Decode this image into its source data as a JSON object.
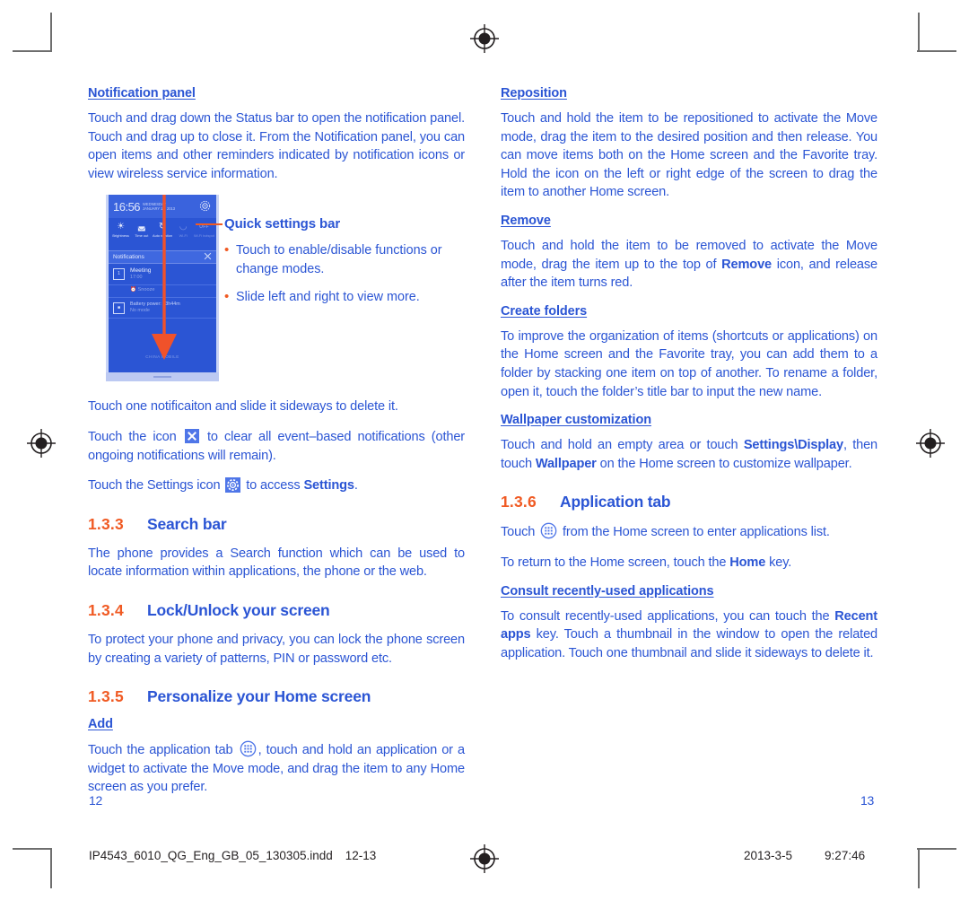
{
  "document": {
    "left_page_number": "12",
    "right_page_number": "13",
    "footer_filename": "IP4543_6010_QG_Eng_GB_05_130305.indd",
    "footer_pages": "12-13",
    "footer_date": "2013-3-5",
    "footer_time": "9:27:46"
  },
  "colors": {
    "body_blue": "#2b55d4",
    "accent_orange": "#f05a23",
    "phone_blue": "#2b55d4"
  },
  "left_column": {
    "notification_panel": {
      "heading": "Notification panel",
      "paragraph": "Touch and drag down the Status bar to open the notification panel. Touch and drag up to close it. From the Notification panel, you can open items and other reminders indicated by notification icons or view wireless service information."
    },
    "figure": {
      "callout_title": "Quick settings bar",
      "bullets": [
        "Touch to enable/disable functions or change modes.",
        "Slide left and right to view more."
      ],
      "phone": {
        "time": "16:56",
        "date_line1": "WEDNESDAY",
        "date_line2": "JANUARY 16, 2013",
        "settings_icon": "gear-icon",
        "quick_settings": [
          {
            "label": "Brightness",
            "glyph": "☀",
            "state": "on"
          },
          {
            "label": "Time out",
            "glyph": "◔",
            "state": "on"
          },
          {
            "label": "Auto rotation",
            "glyph": "⟳",
            "state": "on"
          },
          {
            "label": "Wi-Fi",
            "glyph": "≋",
            "state": "off"
          },
          {
            "label": "Wi-Fi hotspot",
            "glyph": "OFF",
            "state": "off"
          }
        ],
        "notifications_label": "Notifications",
        "clear_icon": "close-icon",
        "items": [
          {
            "title": "Meeting",
            "subtitle": "17:00",
            "icon": "calendar-icon"
          },
          {
            "title": "Battery power: 13h44m",
            "subtitle": "No mode",
            "icon": "battery-icon"
          }
        ],
        "snooze_label": "Snooze",
        "carrier": "CHINA MOBILE"
      }
    },
    "after_figure": {
      "p1": "Touch one notificaiton and slide it sideways to delete it.",
      "p2_before": "Touch the icon",
      "p2_after": "to clear all event–based notifications (other ongoing notifications will remain).",
      "p3_before": "Touch the Settings icon",
      "p3_mid": "to access",
      "p3_bold": "Settings",
      "p3_end": "."
    },
    "sections": [
      {
        "number": "1.3.3",
        "title": "Search bar",
        "paragraph": "The phone provides a Search function which can be used to locate information within applications, the phone or the web."
      },
      {
        "number": "1.3.4",
        "title": "Lock/Unlock your screen",
        "paragraph": "To protect your phone and privacy, you can lock the phone screen by creating a variety of patterns, PIN or password etc."
      },
      {
        "number": "1.3.5",
        "title": "Personalize your Home screen",
        "sub_heading": "Add",
        "add_before": "Touch the application tab",
        "add_after": ", touch and hold an application or a widget to activate the Move mode, and drag the item to any Home screen as you prefer."
      }
    ]
  },
  "right_column": {
    "reposition": {
      "heading": "Reposition",
      "paragraph": "Touch and hold the item to be repositioned to activate the Move mode, drag the item to the desired position and then release. You can move items both on the Home screen and the Favorite tray. Hold the icon on the left or right edge of the screen to drag the item to another Home screen."
    },
    "remove": {
      "heading": "Remove",
      "p_before": "Touch and hold the item to be removed to activate the Move mode, drag the item up to the top of",
      "p_bold": "Remove",
      "p_after": "icon, and release after the item turns red."
    },
    "create_folders": {
      "heading": "Create folders",
      "paragraph": "To improve the organization of items (shortcuts or applications) on the Home screen and the Favorite tray, you can add them to a folder by stacking one item on top of another. To rename a folder, open it, touch the folder’s title bar to input the new name."
    },
    "wallpaper": {
      "heading": "Wallpaper customization",
      "p_before": "Touch and hold an empty area or touch",
      "p_bold1": "Settings\\Display",
      "p_mid": ", then touch",
      "p_bold2": "Wallpaper",
      "p_after": "on the Home screen to customize wallpaper."
    },
    "application_tab": {
      "number": "1.3.6",
      "title": "Application tab",
      "p1_before": "Touch",
      "p1_after": "from the Home screen to enter applications list.",
      "p2_before": "To return to the Home screen, touch the",
      "p2_bold": "Home",
      "p2_after": "key."
    },
    "recent_apps": {
      "heading": "Consult recently-used applications",
      "p_before": "To consult recently-used applications, you can touch the",
      "p_bold": "Recent apps",
      "p_after": "key. Touch a thumbnail in the window to open the related application. Touch one thumbnail and slide it sideways to delete it."
    }
  }
}
